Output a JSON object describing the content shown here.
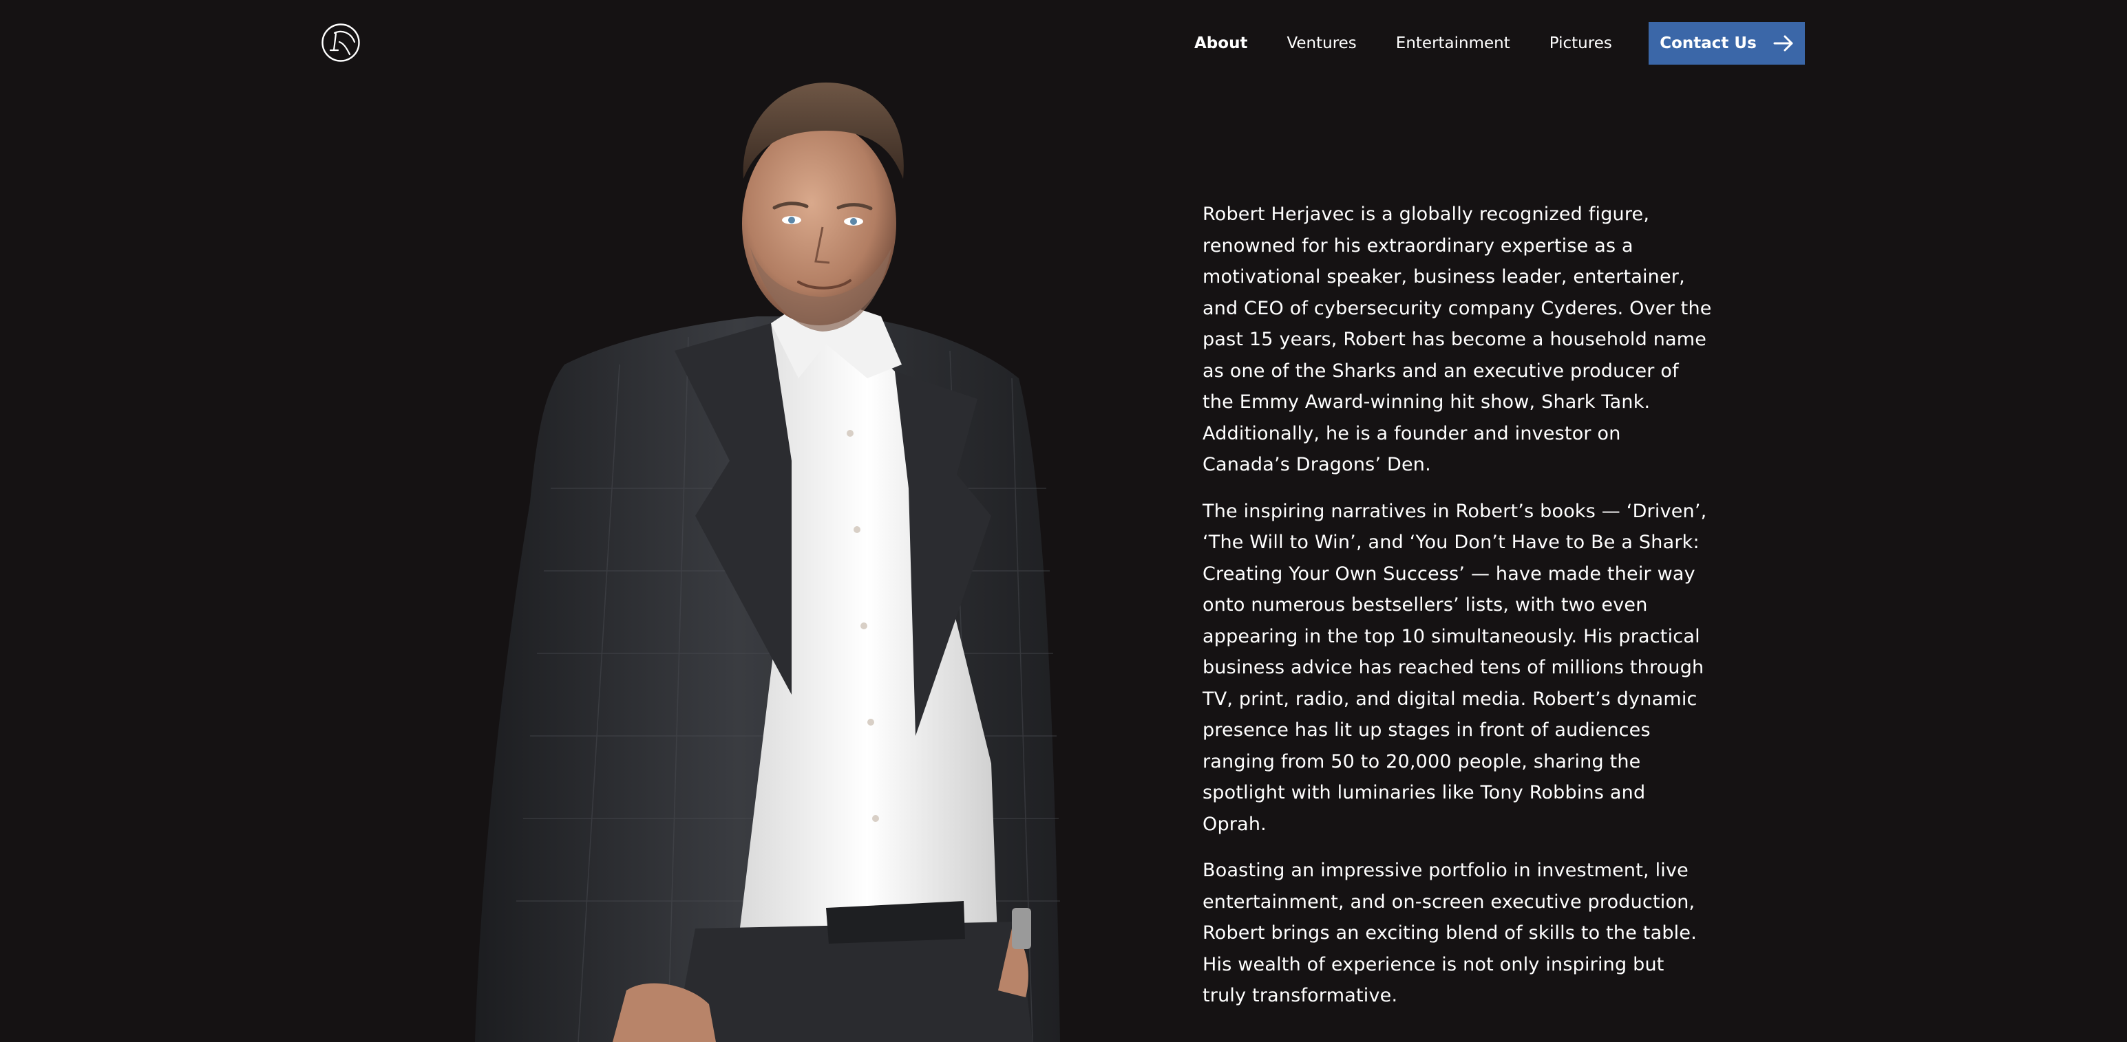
{
  "header": {
    "logo_icon": "rh-monogram-logo-icon",
    "nav": [
      {
        "label": "About",
        "active": true
      },
      {
        "label": "Ventures",
        "active": false
      },
      {
        "label": "Entertainment",
        "active": false
      },
      {
        "label": "Pictures",
        "active": false
      }
    ],
    "contact_label": "Contact Us",
    "contact_icon": "arrow-right-icon",
    "accent_color": "#3b67a8"
  },
  "portrait": {
    "icon": "portrait-photo"
  },
  "bio": {
    "paragraphs": [
      "Robert Herjavec is a globally recognized figure, renowned for his extraordinary expertise as a motivational speaker, business leader, entertainer, and CEO of cybersecurity company Cyderes. Over the past 15 years, Robert has become a household name as one of the Sharks and an executive producer of the Emmy Award-winning hit show, Shark Tank. Additionally, he is a founder and investor on Canada’s Dragons’ Den.",
      "The inspiring narratives in Robert’s books — ‘Driven’, ‘The Will to Win’, and ‘You Don’t Have to Be a Shark: Creating Your Own Success’ — have made their way onto numerous bestsellers’ lists, with two even appearing in the top 10 simultaneously. His practical business advice has reached tens of millions through TV, print, radio, and digital media. Robert’s dynamic presence has lit up stages in front of audiences ranging from 50 to 20,000 people, sharing the spotlight with luminaries like Tony Robbins and Oprah.",
      "Boasting an impressive portfolio in investment, live entertainment, and on-screen executive production, Robert brings an exciting blend of skills to the table. His wealth of experience is not only inspiring but truly transformative."
    ]
  },
  "colors": {
    "background": "#151213",
    "text": "#ffffff"
  }
}
